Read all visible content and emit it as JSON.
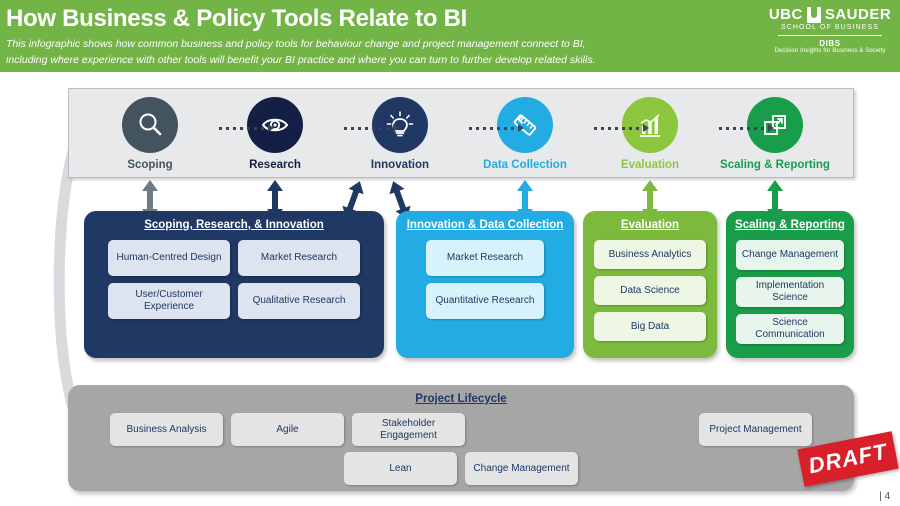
{
  "header": {
    "title": "How Business & Policy Tools Relate to BI",
    "subtitle_line1": "This infographic shows how common business and policy tools for behaviour change and project management connect to BI,",
    "subtitle_line2": "including where experience with other tools will benefit your BI practice and where you can turn to further develop related skills.",
    "background_color": "#73b446",
    "logo": {
      "brand_left": "UBC",
      "brand_right": "SAUDER",
      "school": "SCHOOL OF BUSINESS",
      "unit": "DIBS",
      "tagline": "Decision Insights for Business & Society"
    }
  },
  "process": {
    "stages": [
      {
        "label": "Scoping",
        "icon": "magnifier-icon",
        "color": "#44545f",
        "label_color": "#44545f"
      },
      {
        "label": "Research",
        "icon": "eye-icon",
        "color": "#141f45",
        "label_color": "#141f45"
      },
      {
        "label": "Innovation",
        "icon": "lightbulb-icon",
        "color": "#1f3864",
        "label_color": "#1f3864"
      },
      {
        "label": "Data Collection",
        "icon": "ruler-icon",
        "color": "#23ace3",
        "label_color": "#23ace3"
      },
      {
        "label": "Evaluation",
        "icon": "bar-chart-icon",
        "color": "#8cc63e",
        "label_color": "#8cc63e"
      },
      {
        "label": "Scaling & Reporting",
        "icon": "scale-out-icon",
        "color": "#1a9d4a",
        "label_color": "#1a9d4a"
      }
    ]
  },
  "panels": [
    {
      "title": "Scoping, Research, & Innovation",
      "color": "#1f3864",
      "chips": [
        "Human-Centred Design",
        "Market Research",
        "User/Customer Experience",
        "Qualitative Research"
      ]
    },
    {
      "title": "Innovation & Data Collection",
      "color": "#23ace3",
      "chips": [
        "Market Research",
        "Quantitative Research"
      ]
    },
    {
      "title": "Evaluation",
      "color": "#7cba3d",
      "chips": [
        "Business Analytics",
        "Data Science",
        "Big Data"
      ]
    },
    {
      "title": "Scaling & Reporting",
      "color": "#1a9d4a",
      "chips": [
        "Change Management",
        "Implementation Science",
        "Science Communication"
      ]
    }
  ],
  "lifecycle": {
    "title": "Project Lifecycle",
    "color": "#a6a6a6",
    "chips": [
      "Business Analysis",
      "Agile",
      "Stakeholder Engagement",
      "Project Management",
      "Lean",
      "Change Management"
    ]
  },
  "stamp": {
    "label": "DRAFT",
    "color": "#d8202a"
  },
  "page_number": "| 4"
}
